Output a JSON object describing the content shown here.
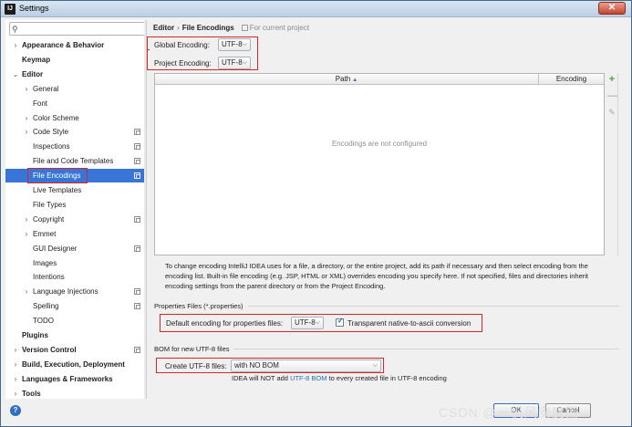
{
  "window": {
    "title": "Settings",
    "icon": "IJ"
  },
  "search": {
    "placeholder": "",
    "value": ""
  },
  "sidebar": {
    "items": [
      {
        "label": "Appearance & Behavior",
        "arrow": "›",
        "bold": true
      },
      {
        "label": "Keymap",
        "arrow": "",
        "bold": true
      },
      {
        "label": "Editor",
        "arrow": "⌄",
        "bold": true
      },
      {
        "label": "General",
        "arrow": "›",
        "bold": false
      },
      {
        "label": "Font",
        "arrow": "",
        "bold": false
      },
      {
        "label": "Color Scheme",
        "arrow": "›",
        "bold": false
      },
      {
        "label": "Code Style",
        "arrow": "›",
        "bold": false,
        "copy": true
      },
      {
        "label": "Inspections",
        "arrow": "",
        "bold": false,
        "copy": true
      },
      {
        "label": "File and Code Templates",
        "arrow": "",
        "bold": false,
        "copy": true
      },
      {
        "label": "File Encodings",
        "arrow": "",
        "bold": false,
        "copy": true,
        "selected": true
      },
      {
        "label": "Live Templates",
        "arrow": "",
        "bold": false
      },
      {
        "label": "File Types",
        "arrow": "",
        "bold": false
      },
      {
        "label": "Copyright",
        "arrow": "›",
        "bold": false,
        "copy": true
      },
      {
        "label": "Emmet",
        "arrow": "›",
        "bold": false
      },
      {
        "label": "GUI Designer",
        "arrow": "",
        "bold": false,
        "copy": true
      },
      {
        "label": "Images",
        "arrow": "",
        "bold": false
      },
      {
        "label": "Intentions",
        "arrow": "",
        "bold": false
      },
      {
        "label": "Language Injections",
        "arrow": "›",
        "bold": false,
        "copy": true
      },
      {
        "label": "Spelling",
        "arrow": "",
        "bold": false,
        "copy": true
      },
      {
        "label": "TODO",
        "arrow": "",
        "bold": false
      },
      {
        "label": "Plugins",
        "arrow": "",
        "bold": true
      },
      {
        "label": "Version Control",
        "arrow": "›",
        "bold": true,
        "copy": true
      },
      {
        "label": "Build, Execution, Deployment",
        "arrow": "›",
        "bold": true
      },
      {
        "label": "Languages & Frameworks",
        "arrow": "›",
        "bold": true
      },
      {
        "label": "Tools",
        "arrow": "›",
        "bold": true
      }
    ]
  },
  "breadcrumb": {
    "root": "Editor",
    "separator": "›",
    "current": "File Encodings",
    "hint": "For current project"
  },
  "encodings": {
    "global_label": "Global Encoding:",
    "global_value": "UTF-8",
    "project_label": "Project Encoding:",
    "project_value": "UTF-8"
  },
  "table": {
    "col_path": "Path",
    "col_encoding": "Encoding",
    "empty_text": "Encodings are not configured"
  },
  "description": "To change encoding IntelliJ IDEA uses for a file, a directory, or the entire project, add its path if necessary and then select encoding from the encoding list. Built-in file encoding (e.g. JSP, HTML or XML) overrides encoding you specify here. If not specified, files and directories inherit encoding settings from the parent directory or from the Project Encoding.",
  "properties": {
    "section_title": "Properties Files (*.properties)",
    "default_label": "Default encoding for properties files:",
    "default_value": "UTF-8",
    "transparent_label": "Transparent native-to-ascii conversion",
    "transparent_checked": true
  },
  "bom": {
    "section_title": "BOM for new UTF-8 files",
    "create_label": "Create UTF-8 files:",
    "create_value": "with NO BOM",
    "note_prefix": "IDEA will NOT add ",
    "note_link": "UTF-8 BOM",
    "note_suffix": " to every created file in UTF-8 encoding"
  },
  "buttons": {
    "ok": "OK",
    "cancel": "Cancel",
    "help": "?"
  },
  "watermark": "CSDN @一帆风安度因",
  "colors": {
    "highlight_red": "#d6262a",
    "selection": "#3875d7",
    "link": "#2470b3"
  }
}
